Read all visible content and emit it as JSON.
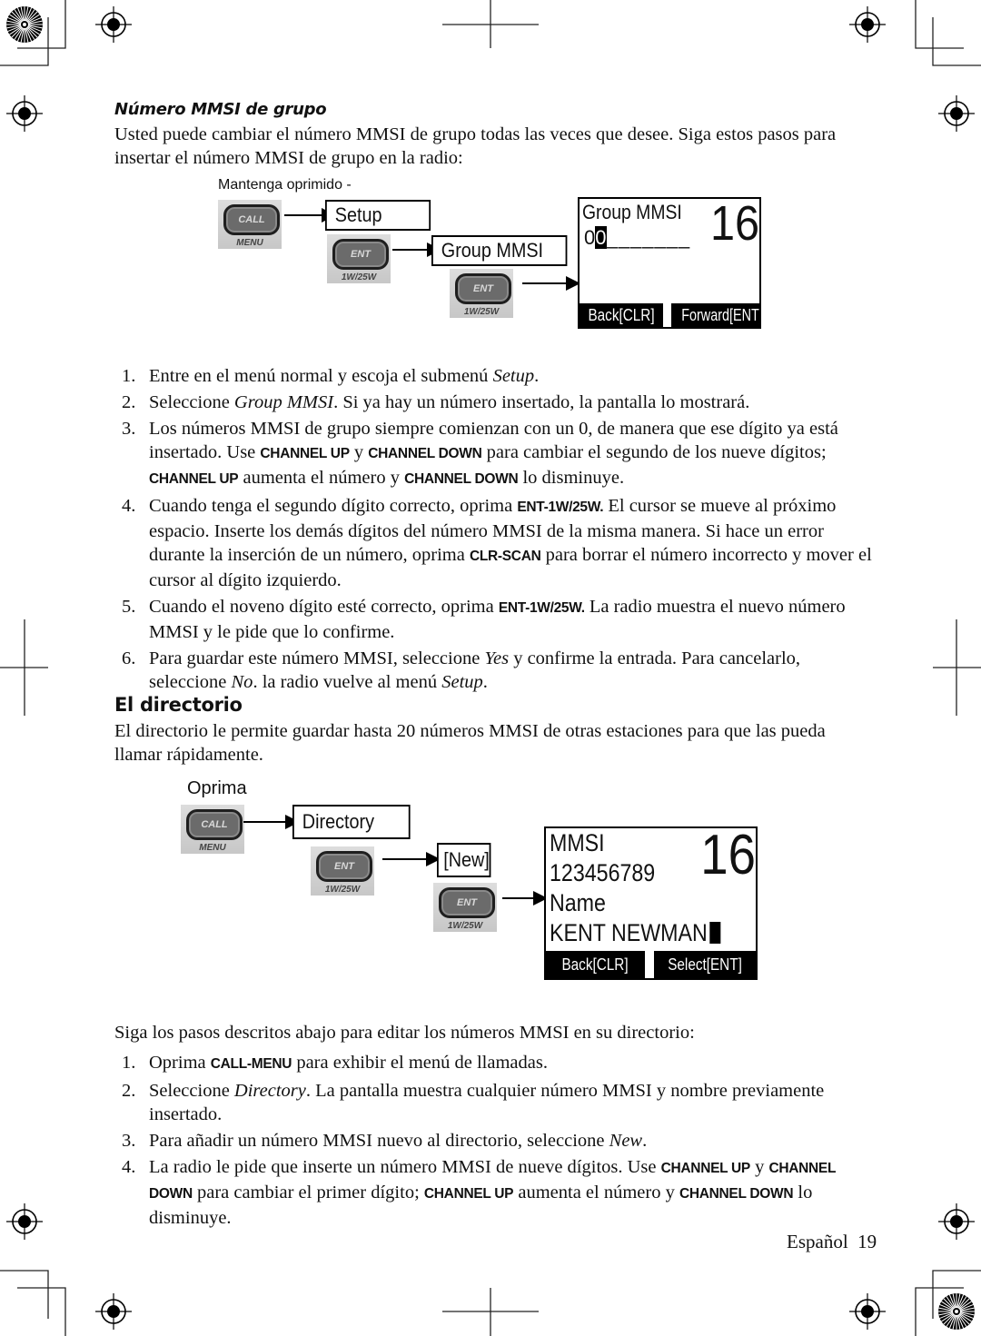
{
  "section1": {
    "subheading": "Número MMSI de grupo",
    "intro": "Usted puede cambiar el número MMSI de grupo todas las veces que desee.  Siga estos pasos para insertar el número MMSI de grupo en la radio:",
    "diagram": {
      "caption": "Mantenga oprimido -",
      "call_key": {
        "label": "CALL",
        "sub": "MENU"
      },
      "ent_key": {
        "label": "ENT",
        "sub": "1W/25W"
      },
      "menu_setup": "Setup",
      "menu_group_mmsi": "Group MMSI",
      "lcd": {
        "title": "Group MMSI",
        "channel": "16",
        "entry_fixed": "0",
        "entry_cursor": "0",
        "entry_blanks": "_______",
        "softkey_left": "Back[CLR]",
        "softkey_right": "Forward[ENT]"
      }
    },
    "steps": [
      {
        "num": "1.",
        "parts": [
          {
            "t": "Entre en el menú normal y escoja el submenú "
          },
          {
            "t": "Setup",
            "s": "it"
          },
          {
            "t": "."
          }
        ]
      },
      {
        "num": "2.",
        "parts": [
          {
            "t": "Seleccione "
          },
          {
            "t": "Group MMSI",
            "s": "it"
          },
          {
            "t": ". Si ya hay un número insertado, la pantalla lo mostrará."
          }
        ]
      },
      {
        "num": "3.",
        "parts": [
          {
            "t": "Los números MMSI de grupo siempre comienzan con un 0, de manera que ese dígito ya está insertado. Use "
          },
          {
            "t": "CHANNEL UP",
            "s": "kw"
          },
          {
            "t": " y "
          },
          {
            "t": "CHANNEL DOWN",
            "s": "kw"
          },
          {
            "t": " para cambiar el segundo de los nueve dígitos; "
          },
          {
            "t": "CHANNEL UP",
            "s": "kw"
          },
          {
            "t": " aumenta el número y "
          },
          {
            "t": "CHANNEL DOWN",
            "s": "kw"
          },
          {
            "t": " lo disminuye."
          }
        ]
      },
      {
        "num": "4.",
        "parts": [
          {
            "t": "Cuando tenga el segundo dígito correcto, oprima "
          },
          {
            "t": "ENT-1W/25W.",
            "s": "kw"
          },
          {
            "t": "  El cursor se mueve al próximo espacio. Inserte los demás dígitos del número MMSI de la misma manera. Si hace un error durante la inserción de un número, oprima "
          },
          {
            "t": "CLR-SCAN",
            "s": "kw"
          },
          {
            "t": " para borrar el número incorrecto y mover el cursor al dígito izquierdo."
          }
        ]
      },
      {
        "num": "5.",
        "parts": [
          {
            "t": "Cuando el noveno dígito esté correcto, oprima "
          },
          {
            "t": "ENT-1W/25W.",
            "s": "kw"
          },
          {
            "t": "  La radio muestra el nuevo número MMSI y le pide que lo confirme."
          }
        ]
      },
      {
        "num": "6.",
        "parts": [
          {
            "t": "Para guardar este número MMSI, seleccione "
          },
          {
            "t": "Yes",
            "s": "it"
          },
          {
            "t": " y confirme la entrada. Para cancelarlo, seleccione "
          },
          {
            "t": "No",
            "s": "it"
          },
          {
            "t": ". la radio vuelve al menú "
          },
          {
            "t": "Setup",
            "s": "it"
          },
          {
            "t": "."
          }
        ]
      }
    ]
  },
  "section2": {
    "heading": "El directorio",
    "intro": "El directorio le permite guardar hasta 20 números MMSI de otras estaciones para que las pueda llamar rápidamente.",
    "diagram": {
      "caption": "Oprima",
      "call_key": {
        "label": "CALL",
        "sub": "MENU"
      },
      "ent_key": {
        "label": "ENT",
        "sub": "1W/25W"
      },
      "menu_directory": "Directory",
      "menu_new": "[New]",
      "lcd": {
        "line1": "MMSI",
        "line2": "123456789",
        "line3": "Name",
        "line4": "KENT NEWMAN",
        "channel": "16",
        "softkey_left": "Back[CLR]",
        "softkey_right": "Select[ENT]"
      }
    },
    "lead": "Siga los pasos descritos abajo para editar los números MMSI en su directorio:",
    "steps": [
      {
        "num": "1.",
        "parts": [
          {
            "t": "Oprima "
          },
          {
            "t": "CALL-MENU",
            "s": "kw"
          },
          {
            "t": " para exhibir el menú de llamadas."
          }
        ]
      },
      {
        "num": "2.",
        "parts": [
          {
            "t": "Seleccione "
          },
          {
            "t": "Directory",
            "s": "it"
          },
          {
            "t": ". La pantalla muestra cualquier número MMSI y nombre previamente insertado."
          }
        ]
      },
      {
        "num": "3.",
        "parts": [
          {
            "t": "Para añadir un número MMSI nuevo al directorio, seleccione "
          },
          {
            "t": "New",
            "s": "it"
          },
          {
            "t": "."
          }
        ]
      },
      {
        "num": "4.",
        "parts": [
          {
            "t": "La radio le pide que inserte un número MMSI de nueve dígitos. Use "
          },
          {
            "t": "CHANNEL UP",
            "s": "kw"
          },
          {
            "t": " y "
          },
          {
            "t": "CHANNEL DOWN",
            "s": "kw"
          },
          {
            "t": " para cambiar el primer dígito; "
          },
          {
            "t": "CHANNEL UP",
            "s": "kw"
          },
          {
            "t": " aumenta el número y "
          },
          {
            "t": "CHANNEL DOWN",
            "s": "kw"
          },
          {
            "t": " lo disminuye."
          }
        ]
      }
    ]
  },
  "footer": {
    "language": "Español",
    "page_number": "19"
  }
}
